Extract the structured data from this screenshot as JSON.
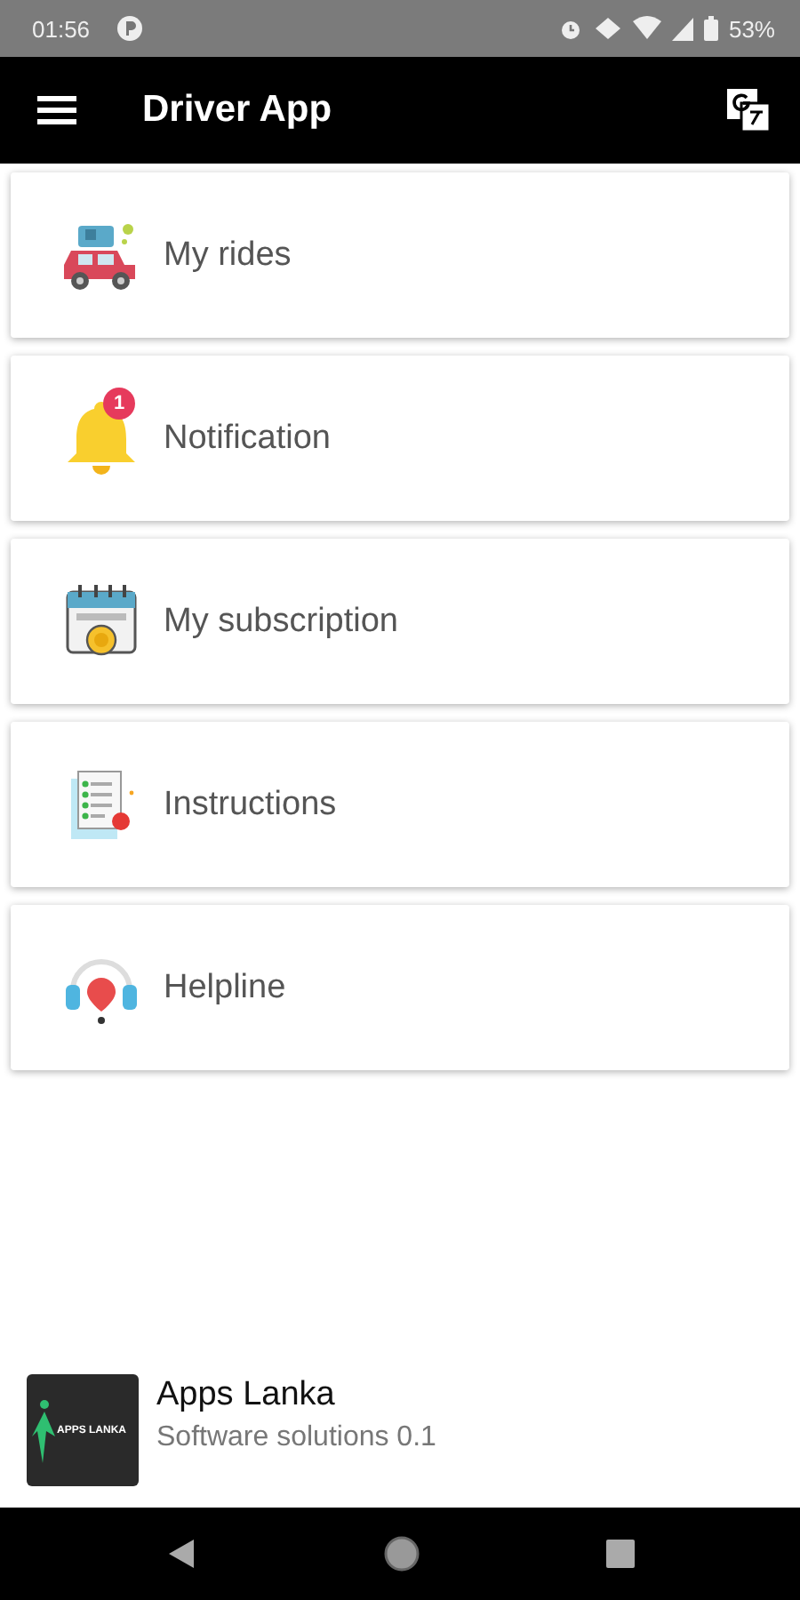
{
  "status_bar": {
    "time": "01:56",
    "battery": "53%"
  },
  "app_bar": {
    "title": "Driver App"
  },
  "menu": [
    {
      "kind": "car",
      "label": "My rides"
    },
    {
      "kind": "bell",
      "label": "Notification",
      "badge": "1"
    },
    {
      "kind": "calendar",
      "label": "My subscription"
    },
    {
      "kind": "checklist",
      "label": "Instructions"
    },
    {
      "kind": "headset",
      "label": "Helpline"
    }
  ],
  "footer": {
    "logo_text": "APPS LANKA",
    "title": "Apps Lanka",
    "subtitle": "Software solutions 0.1"
  }
}
